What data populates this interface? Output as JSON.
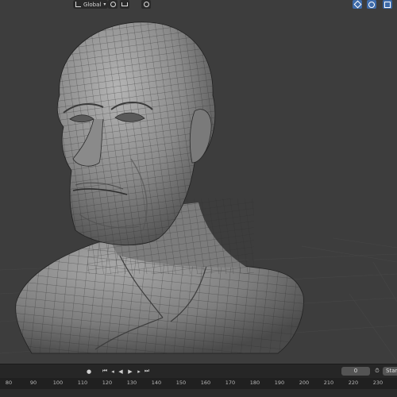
{
  "header": {
    "orientation_label": "Global",
    "icons": [
      "transform-orientation-icon",
      "pivot-icon",
      "snap-icon",
      "proportional-edit-icon",
      "gizmo-icon",
      "overlay-icon",
      "xray-icon"
    ]
  },
  "timeline": {
    "current_frame": "0",
    "start_label": "Start",
    "controls": [
      "record-icon",
      "jump-start-icon",
      "prev-keyframe-icon",
      "play-reverse-icon",
      "play-icon",
      "next-keyframe-icon",
      "jump-end-icon"
    ],
    "ruler_ticks": [
      "80",
      "90",
      "100",
      "110",
      "120",
      "130",
      "140",
      "150",
      "160",
      "170",
      "180",
      "190",
      "200",
      "210",
      "220",
      "230"
    ]
  },
  "colors": {
    "viewport_bg": "#3d3d3d",
    "mesh_base": "#8e8e8e",
    "wire": "#2a2a2a",
    "accent_blue": "#3d6aa8"
  }
}
